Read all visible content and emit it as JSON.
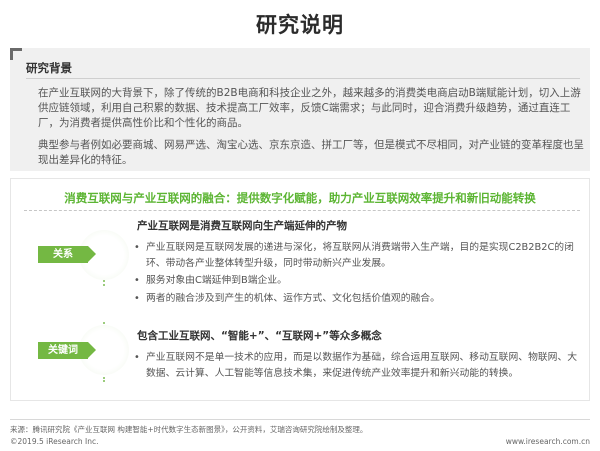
{
  "title": "研究说明",
  "background": {
    "heading": "研究背景",
    "paragraphs": [
      "在产业互联网的大背景下，除了传统的B2B电商和科技企业之外，越来越多的消费类电商启动B端赋能计划，切入上游供应链领域，利用自己积累的数据、技术提高工厂效率，反馈C端需求；与此同时，迎合消费升级趋势，通过直连工厂，为消费者提供高性价比和个性化的商品。",
      "典型参与者例如必要商城、网易严选、淘宝心选、京东京造、拼工厂等，但是模式不尽相同，对产业链的变革程度也呈现出差异化的特征。"
    ]
  },
  "highlight": {
    "heading": "消费互联网与产业互联网的融合：提供数字化赋能，助力产业互联网效率提升和新旧动能转换",
    "sections": [
      {
        "tag": "关系",
        "heading": "产业互联网是消费互联网向生产端延伸的产物",
        "bullets": [
          "产业互联网是互联网发展的递进与深化，将互联网从消费端带入生产端，目的是实现C2B2B2C的闭环、带动各产业整体转型升级，同时带动新兴产业发展。",
          "服务对象由C端延伸到B端企业。",
          "两者的融合涉及到产生的机体、运作方式、文化包括价值观的融合。"
        ]
      },
      {
        "tag": "关键词",
        "heading": "包含工业互联网、“智能+”、“互联网+”等众多概念",
        "bullets": [
          "产业互联网不是单一技术的应用，而是以数据作为基础，综合运用互联网、移动互联网、物联网、大数据、云计算、人工智能等信息技术集，来促进传统产业效率提升和新兴动能的转换。"
        ]
      }
    ]
  },
  "footer": {
    "source": "来源：腾讯研究院《产业互联网 构建智能+时代数字生态新图景》，公开资料，艾瑞咨询研究院绘制及整理。",
    "copyright": "©2019.5 iResearch Inc.",
    "site": "www.iresearch.com.cn"
  },
  "colors": {
    "accent_green": "#74b843",
    "heading_green": "#5cb533",
    "panel_gray": "#f0f0f0"
  }
}
